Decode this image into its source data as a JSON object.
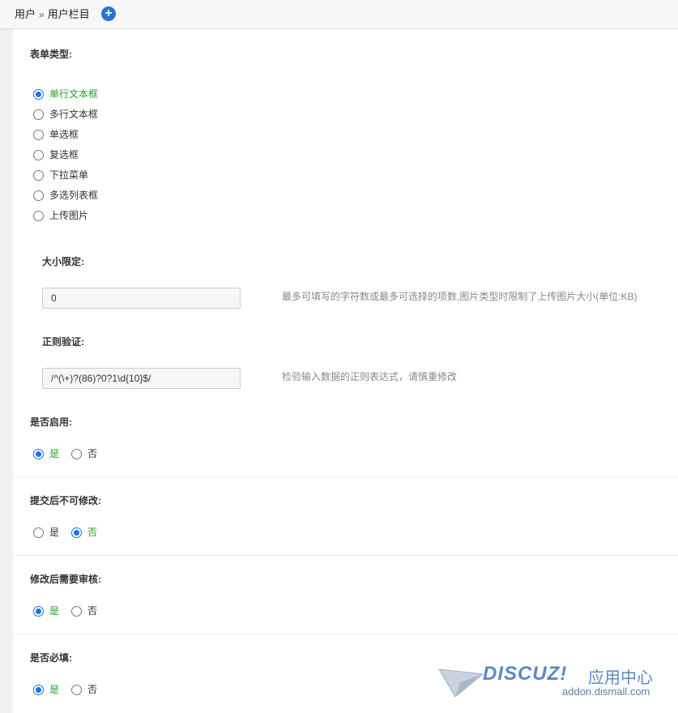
{
  "breadcrumb": {
    "root": "用户",
    "separator": "»",
    "current": "用户栏目"
  },
  "form": {
    "form_type": {
      "label": "表单类型:",
      "options": [
        "单行文本框",
        "多行文本框",
        "单选框",
        "复选框",
        "下拉菜单",
        "多选列表框",
        "上传图片"
      ],
      "selected": "单行文本框"
    },
    "size_limit": {
      "label": "大小限定:",
      "value": "0",
      "hint": "最多可填写的字符数或最多可选择的项数,图片类型时限制了上传图片大小(单位:KB)"
    },
    "regex": {
      "label": "正则验证:",
      "value": "/^(\\+)?(86)?0?1\\d{10}$/",
      "hint": "检验输入数据的正则表达式，请慎重修改"
    },
    "enabled": {
      "label": "是否启用:",
      "yes": "是",
      "no": "否",
      "selected": "yes"
    },
    "locked_after_submit": {
      "label": "提交后不可修改:",
      "yes": "是",
      "no": "否",
      "selected": "no"
    },
    "review_after_edit": {
      "label": "修改后需要审核:",
      "yes": "是",
      "no": "否",
      "selected": "yes"
    },
    "required": {
      "label": "是否必填:",
      "yes": "是",
      "no": "否",
      "selected": "yes"
    }
  },
  "watermark": {
    "logo": "DISCUZ!",
    "cn": "应用中心",
    "sub": "addon.dismall.com"
  },
  "colors": {
    "accent": "#1a73e8",
    "selected_text": "#2a9d2a",
    "hint": "#888888"
  }
}
